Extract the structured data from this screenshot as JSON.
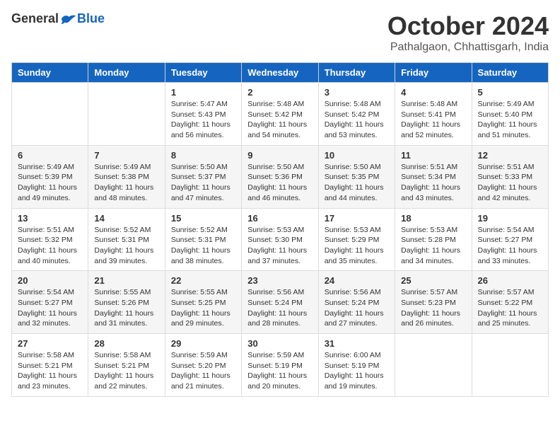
{
  "header": {
    "logo_general": "General",
    "logo_blue": "Blue",
    "month_title": "October 2024",
    "subtitle": "Pathalgaon, Chhattisgarh, India"
  },
  "days_of_week": [
    "Sunday",
    "Monday",
    "Tuesday",
    "Wednesday",
    "Thursday",
    "Friday",
    "Saturday"
  ],
  "weeks": [
    [
      {
        "day": "",
        "info": ""
      },
      {
        "day": "",
        "info": ""
      },
      {
        "day": "1",
        "info": "Sunrise: 5:47 AM\nSunset: 5:43 PM\nDaylight: 11 hours and 56 minutes."
      },
      {
        "day": "2",
        "info": "Sunrise: 5:48 AM\nSunset: 5:42 PM\nDaylight: 11 hours and 54 minutes."
      },
      {
        "day": "3",
        "info": "Sunrise: 5:48 AM\nSunset: 5:42 PM\nDaylight: 11 hours and 53 minutes."
      },
      {
        "day": "4",
        "info": "Sunrise: 5:48 AM\nSunset: 5:41 PM\nDaylight: 11 hours and 52 minutes."
      },
      {
        "day": "5",
        "info": "Sunrise: 5:49 AM\nSunset: 5:40 PM\nDaylight: 11 hours and 51 minutes."
      }
    ],
    [
      {
        "day": "6",
        "info": "Sunrise: 5:49 AM\nSunset: 5:39 PM\nDaylight: 11 hours and 49 minutes."
      },
      {
        "day": "7",
        "info": "Sunrise: 5:49 AM\nSunset: 5:38 PM\nDaylight: 11 hours and 48 minutes."
      },
      {
        "day": "8",
        "info": "Sunrise: 5:50 AM\nSunset: 5:37 PM\nDaylight: 11 hours and 47 minutes."
      },
      {
        "day": "9",
        "info": "Sunrise: 5:50 AM\nSunset: 5:36 PM\nDaylight: 11 hours and 46 minutes."
      },
      {
        "day": "10",
        "info": "Sunrise: 5:50 AM\nSunset: 5:35 PM\nDaylight: 11 hours and 44 minutes."
      },
      {
        "day": "11",
        "info": "Sunrise: 5:51 AM\nSunset: 5:34 PM\nDaylight: 11 hours and 43 minutes."
      },
      {
        "day": "12",
        "info": "Sunrise: 5:51 AM\nSunset: 5:33 PM\nDaylight: 11 hours and 42 minutes."
      }
    ],
    [
      {
        "day": "13",
        "info": "Sunrise: 5:51 AM\nSunset: 5:32 PM\nDaylight: 11 hours and 40 minutes."
      },
      {
        "day": "14",
        "info": "Sunrise: 5:52 AM\nSunset: 5:31 PM\nDaylight: 11 hours and 39 minutes."
      },
      {
        "day": "15",
        "info": "Sunrise: 5:52 AM\nSunset: 5:31 PM\nDaylight: 11 hours and 38 minutes."
      },
      {
        "day": "16",
        "info": "Sunrise: 5:53 AM\nSunset: 5:30 PM\nDaylight: 11 hours and 37 minutes."
      },
      {
        "day": "17",
        "info": "Sunrise: 5:53 AM\nSunset: 5:29 PM\nDaylight: 11 hours and 35 minutes."
      },
      {
        "day": "18",
        "info": "Sunrise: 5:53 AM\nSunset: 5:28 PM\nDaylight: 11 hours and 34 minutes."
      },
      {
        "day": "19",
        "info": "Sunrise: 5:54 AM\nSunset: 5:27 PM\nDaylight: 11 hours and 33 minutes."
      }
    ],
    [
      {
        "day": "20",
        "info": "Sunrise: 5:54 AM\nSunset: 5:27 PM\nDaylight: 11 hours and 32 minutes."
      },
      {
        "day": "21",
        "info": "Sunrise: 5:55 AM\nSunset: 5:26 PM\nDaylight: 11 hours and 31 minutes."
      },
      {
        "day": "22",
        "info": "Sunrise: 5:55 AM\nSunset: 5:25 PM\nDaylight: 11 hours and 29 minutes."
      },
      {
        "day": "23",
        "info": "Sunrise: 5:56 AM\nSunset: 5:24 PM\nDaylight: 11 hours and 28 minutes."
      },
      {
        "day": "24",
        "info": "Sunrise: 5:56 AM\nSunset: 5:24 PM\nDaylight: 11 hours and 27 minutes."
      },
      {
        "day": "25",
        "info": "Sunrise: 5:57 AM\nSunset: 5:23 PM\nDaylight: 11 hours and 26 minutes."
      },
      {
        "day": "26",
        "info": "Sunrise: 5:57 AM\nSunset: 5:22 PM\nDaylight: 11 hours and 25 minutes."
      }
    ],
    [
      {
        "day": "27",
        "info": "Sunrise: 5:58 AM\nSunset: 5:21 PM\nDaylight: 11 hours and 23 minutes."
      },
      {
        "day": "28",
        "info": "Sunrise: 5:58 AM\nSunset: 5:21 PM\nDaylight: 11 hours and 22 minutes."
      },
      {
        "day": "29",
        "info": "Sunrise: 5:59 AM\nSunset: 5:20 PM\nDaylight: 11 hours and 21 minutes."
      },
      {
        "day": "30",
        "info": "Sunrise: 5:59 AM\nSunset: 5:19 PM\nDaylight: 11 hours and 20 minutes."
      },
      {
        "day": "31",
        "info": "Sunrise: 6:00 AM\nSunset: 5:19 PM\nDaylight: 11 hours and 19 minutes."
      },
      {
        "day": "",
        "info": ""
      },
      {
        "day": "",
        "info": ""
      }
    ]
  ]
}
